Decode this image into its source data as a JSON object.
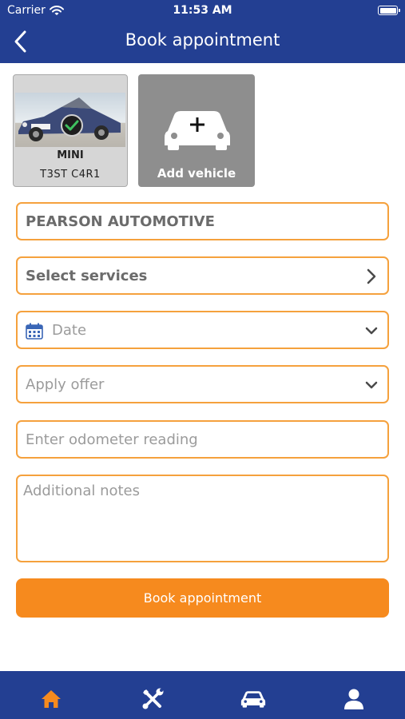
{
  "status_bar": {
    "carrier": "Carrier",
    "time": "11:53 AM"
  },
  "header": {
    "title": "Book appointment",
    "back_icon": "chevron-left-icon"
  },
  "vehicles": [
    {
      "make": "MINI",
      "registration": "T3ST C4R1",
      "selected": true
    }
  ],
  "add_vehicle": {
    "label": "Add vehicle",
    "icon": "car-plus-icon"
  },
  "form": {
    "garage": "PEARSON AUTOMOTIVE",
    "services": "Select services",
    "date_placeholder": "Date",
    "offer_placeholder": "Apply offer",
    "odometer_placeholder": "Enter odometer reading",
    "notes_placeholder": "Additional notes"
  },
  "book_button": "Book appointment",
  "tab_bar": {
    "active": "home",
    "tabs": [
      {
        "name": "home",
        "icon": "home-icon"
      },
      {
        "name": "services",
        "icon": "tools-icon"
      },
      {
        "name": "vehicles",
        "icon": "car-icon"
      },
      {
        "name": "profile",
        "icon": "user-icon"
      }
    ]
  },
  "colors": {
    "brand_blue": "#233f92",
    "accent_orange": "#f68a1e",
    "field_border": "#f5a13d"
  }
}
